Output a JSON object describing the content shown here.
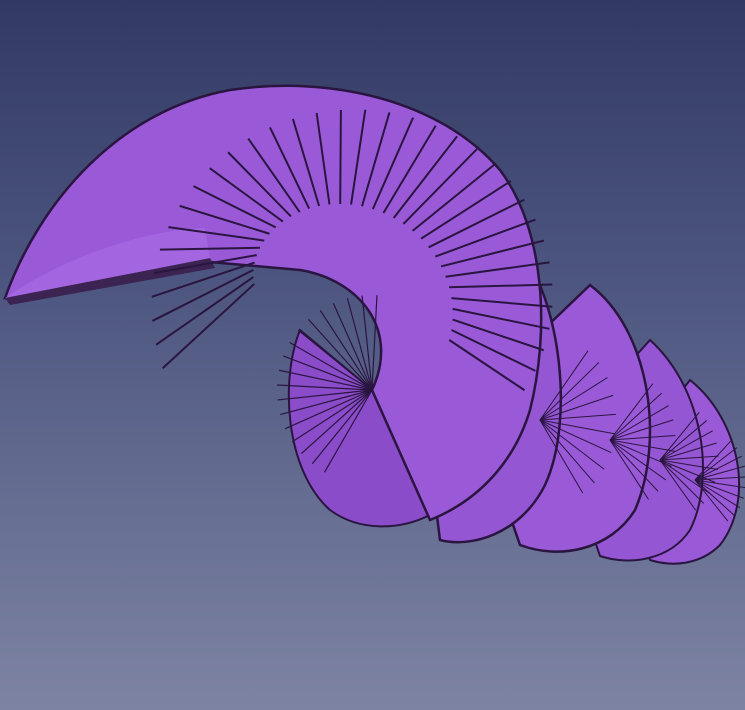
{
  "viewer": {
    "background_top": "#323a64",
    "background_bottom": "#7d84a3"
  },
  "model": {
    "shape": "spiral-staircase-helix",
    "surface_color": "#9a5ad8",
    "surface_shade": "#8a4cc8",
    "edge_color": "#2a1540",
    "side_color": "#3b2352"
  }
}
